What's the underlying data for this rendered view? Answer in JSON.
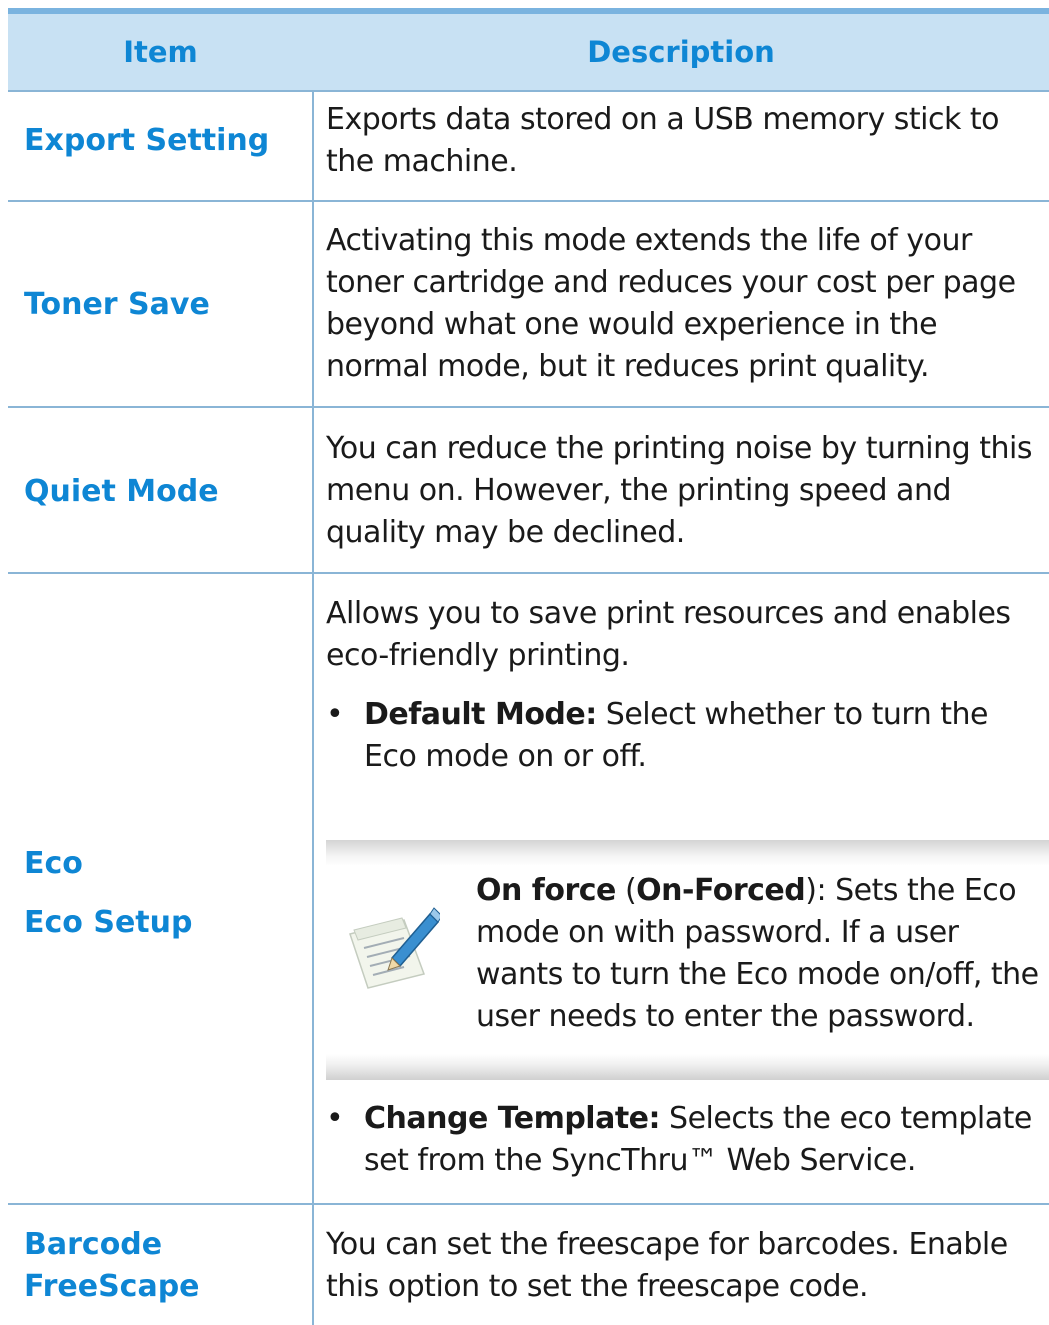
{
  "header": {
    "item": "Item",
    "description": "Description"
  },
  "rows": [
    {
      "item": "Export Setting",
      "description": "Exports data stored on a USB memory stick to the machine."
    },
    {
      "item": "Toner Save",
      "description": "Activating this mode extends the life of your toner cartridge and reduces your cost per page beyond what one would experience in the normal mode, but it reduces print quality."
    },
    {
      "item": "Quiet Mode",
      "description": "You can reduce the printing noise by turning this menu on. However, the printing speed and quality may be declined."
    },
    {
      "item_line1": "Eco",
      "item_line2": "Eco Setup",
      "intro": "Allows you to save print resources and enables eco-friendly printing.",
      "bullet1_label": "Default Mode:",
      "bullet1_text": " Select whether to turn the Eco mode on or off.",
      "note_label1": "On force",
      "note_open": " (",
      "note_label2": "On-Forced",
      "note_close": ")",
      "note_text": ": Sets the Eco mode on with password. If a user wants to turn the Eco mode on/off, the user needs to enter the password.",
      "note_icon": "note-pencil-icon",
      "bullet2_label": "Change Template:",
      "bullet2_text": " Selects the eco template set from the SyncThru™ Web Service."
    },
    {
      "item": "Barcode FreeScape",
      "description": "You can set the freescape for barcodes. Enable this option to set the freescape code."
    }
  ],
  "bullet_glyph": "•",
  "colors": {
    "accent": "#0e86d4",
    "header_bg": "#c8e1f3",
    "rule": "#8ab5d6"
  }
}
